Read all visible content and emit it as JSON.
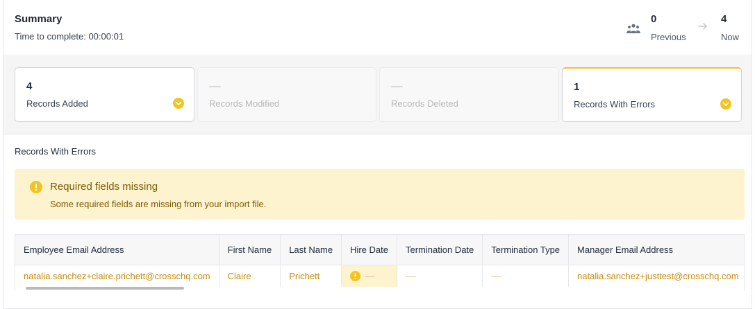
{
  "summary": {
    "title": "Summary",
    "time_to_complete": "Time to complete: 00:00:01",
    "previous_count": "0",
    "previous_label": "Previous",
    "now_count": "4",
    "now_label": "Now",
    "people_icon": "people-icon",
    "arrow_icon": "arrow-right-icon"
  },
  "cards": [
    {
      "count": "4",
      "label": "Records Added",
      "state": "complete",
      "icon": "check-circle-icon"
    },
    {
      "count": "––",
      "label": "Records Modified",
      "state": "disabled"
    },
    {
      "count": "––",
      "label": "Records Deleted",
      "state": "disabled"
    },
    {
      "count": "1",
      "label": "Records With Errors",
      "state": "active",
      "icon": "check-circle-icon"
    }
  ],
  "section_label": "Records With Errors",
  "alert": {
    "icon": "warning-circle-icon",
    "title": "Required fields missing",
    "message": "Some required fields are missing from your import file."
  },
  "table": {
    "columns": [
      "Employee Email Address",
      "First Name",
      "Last Name",
      "Hire Date",
      "Termination Date",
      "Termination Type",
      "Manager Email Address"
    ],
    "rows": [
      [
        "natalia.sanchez+claire.prichett@crosschq.com",
        "Claire",
        "Prichett",
        "––",
        "––",
        "––",
        "natalia.sanchez+justtest@crosschq.com"
      ]
    ]
  },
  "colors": {
    "accent": "#f5c320",
    "alert_bg": "#fdf4cf",
    "link_text": "#c78a0a"
  }
}
